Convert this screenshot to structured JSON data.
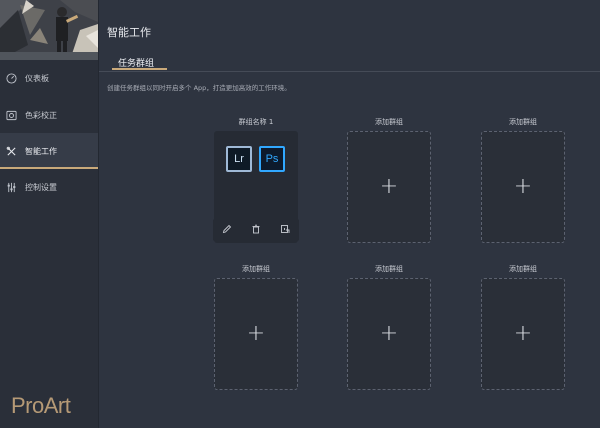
{
  "sidebar": {
    "items": [
      {
        "label": "仪表板",
        "icon": "dashboard-gauge-icon"
      },
      {
        "label": "色彩校正",
        "icon": "color-calibration-icon"
      },
      {
        "label": "智能工作",
        "icon": "smart-work-tools-icon",
        "active": true
      },
      {
        "label": "控制设置",
        "icon": "control-sliders-icon"
      }
    ],
    "brand": "ProArt"
  },
  "main": {
    "title": "智能工作",
    "tab": "任务群组",
    "description": "创建任务群组以同时开启多个 App，打造更加高效的工作环境。",
    "groups": [
      {
        "name": "群组名称 1",
        "apps": [
          "Lr",
          "Ps"
        ]
      },
      {
        "name": "添加群组"
      },
      {
        "name": "添加群组"
      },
      {
        "name": "添加群组"
      },
      {
        "name": "添加群组"
      },
      {
        "name": "添加群组"
      }
    ],
    "plus_symbol": "+"
  },
  "colors": {
    "background": "#2e3440",
    "sidebar": "#2a2f39",
    "accent_gold": "#c9a97a",
    "ps_blue": "#31a8ff"
  }
}
